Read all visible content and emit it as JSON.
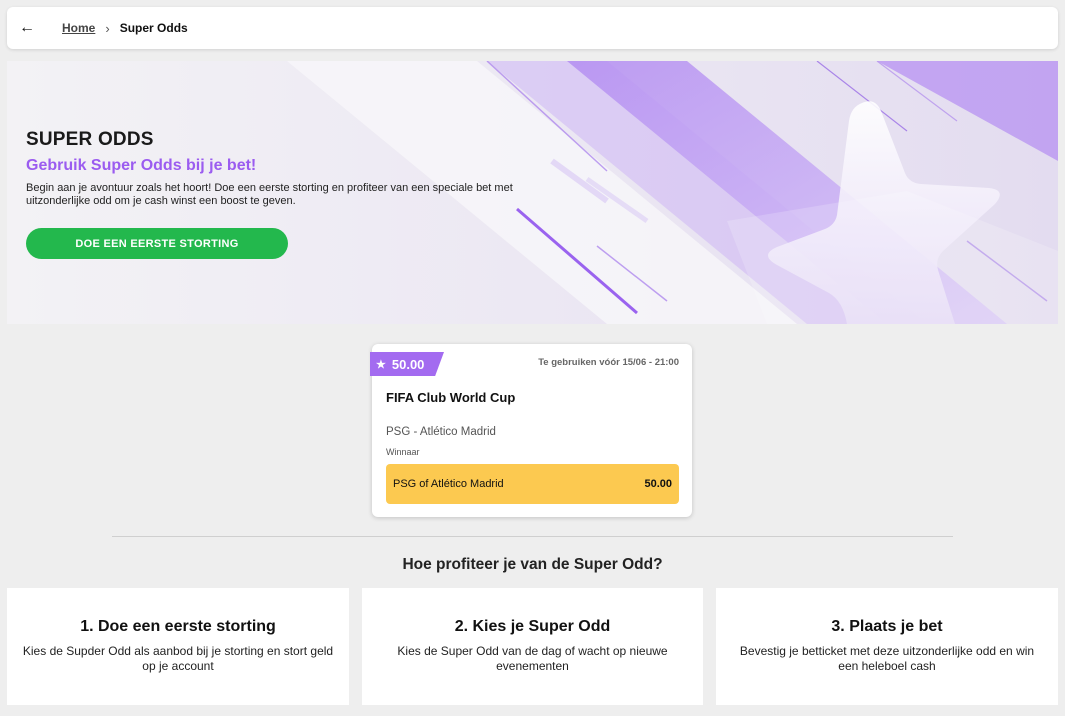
{
  "breadcrumb": {
    "back_icon": "←",
    "home_label": "Home",
    "separator": "›",
    "current_label": "Super Odds"
  },
  "hero": {
    "title": "SUPER ODDS",
    "subtitle": "Gebruik Super Odds bij je bet!",
    "description": "Begin aan je avontuur zoals het hoort! Doe een eerste storting en profiteer van een speciale bet met uitzonderlijke odd om je cash winst een boost te geven.",
    "cta_label": "DOE EEN EERSTE STORTING",
    "image_icon": "star-icon"
  },
  "super_odd": {
    "badge_icon": "★",
    "badge_value": "50.00",
    "expiry": "Te gebruiken vóór 15/06 - 21:00",
    "competition": "FIFA Club World Cup",
    "match": "PSG - Atlético Madrid",
    "market": "Winnaar",
    "selection_label": "PSG of Atlético Madrid",
    "selection_odd": "50.00"
  },
  "how_it_works": {
    "title": "Hoe profiteer je van de Super Odd?",
    "steps": [
      {
        "title": "1. Doe een eerste storting",
        "text": "Kies de Supder Odd als aanbod bij je storting en stort geld op je account"
      },
      {
        "title": "2. Kies je Super Odd",
        "text": "Kies de Super Odd van de dag of wacht op nieuwe evenementen"
      },
      {
        "title": "3. Plaats je bet",
        "text": "Bevestig je betticket met deze uitzonderlijke odd en win een heleboel cash"
      }
    ]
  },
  "colors": {
    "accent_purple": "#9b5cf0",
    "cta_green": "#23b84d",
    "selection_yellow": "#fcc950",
    "background": "#eeeeee"
  }
}
